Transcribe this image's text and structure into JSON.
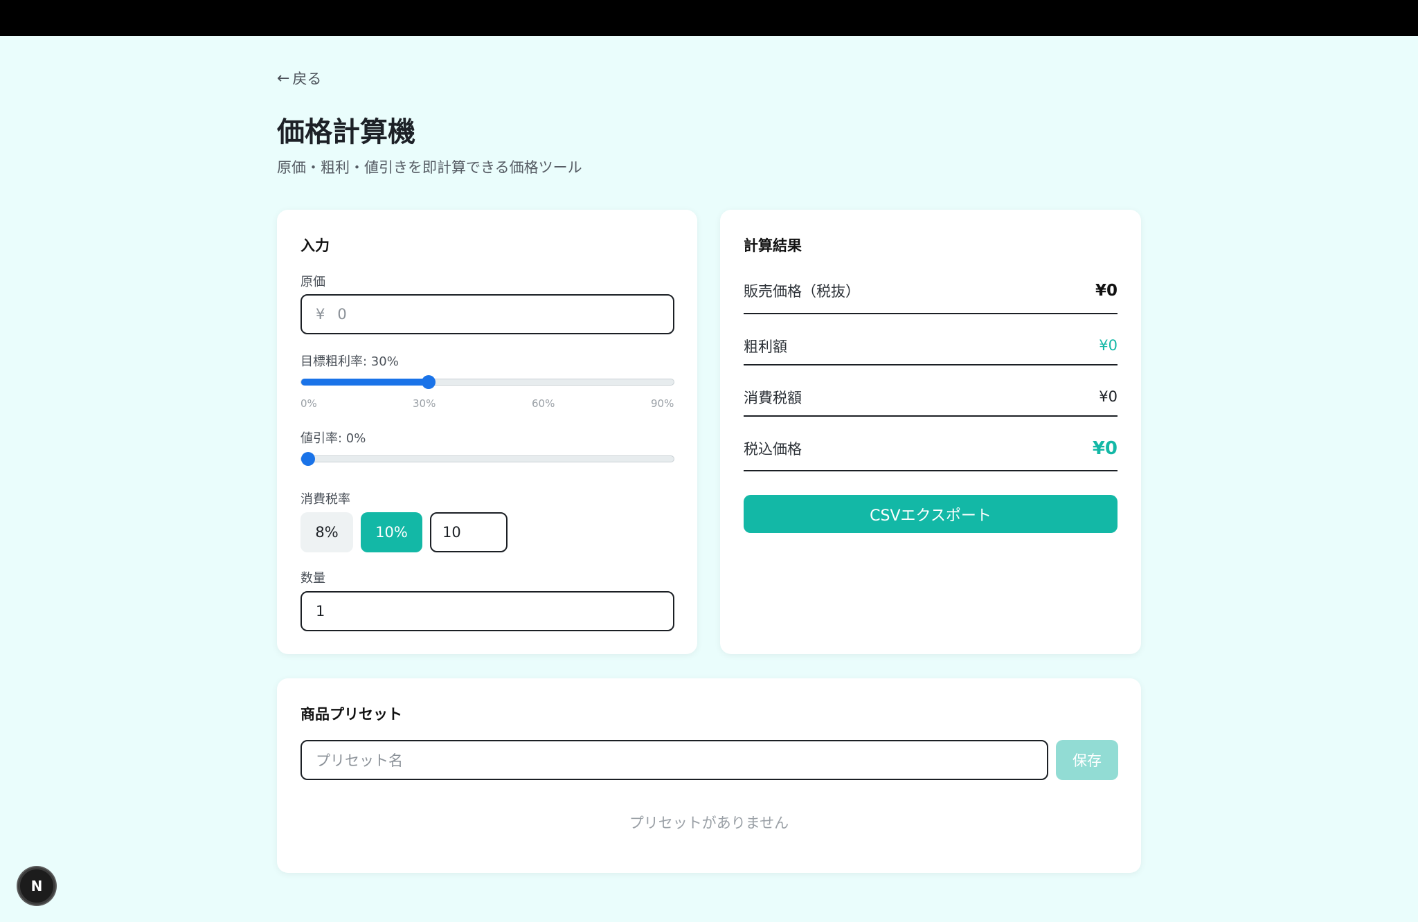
{
  "nav": {
    "back_label": "戻る"
  },
  "page": {
    "title": "価格計算機",
    "subtitle": "原価・粗利・値引きを即計算できる価格ツール"
  },
  "input_card": {
    "title": "入力",
    "cost_label": "原価",
    "cost_currency": "¥",
    "cost_placeholder": "0",
    "margin_label": "目標粗利率: 30%",
    "margin_value_percent": 30,
    "margin_ticks": [
      "0%",
      "30%",
      "60%",
      "90%"
    ],
    "discount_label": "値引率: 0%",
    "discount_value_percent": 0,
    "tax_label": "消費税率",
    "tax_options": [
      "8%",
      "10%"
    ],
    "tax_selected": "10%",
    "tax_custom_value": "10",
    "quantity_label": "数量",
    "quantity_value": "1"
  },
  "result_card": {
    "title": "計算結果",
    "rows": [
      {
        "label": "販売価格（税抜）",
        "value": "¥0"
      },
      {
        "label": "粗利額",
        "value": "¥0"
      },
      {
        "label": "消費税額",
        "value": "¥0"
      },
      {
        "label": "税込価格",
        "value": "¥0"
      }
    ],
    "export_label": "CSVエクスポート"
  },
  "preset_card": {
    "title": "商品プリセット",
    "name_placeholder": "プリセット名",
    "save_label": "保存",
    "empty_message": "プリセットがありません"
  },
  "colors": {
    "accent": "#13b8a6",
    "slider": "#1a73e8",
    "background": "#eafdfc"
  },
  "badge": {
    "letter": "N"
  }
}
